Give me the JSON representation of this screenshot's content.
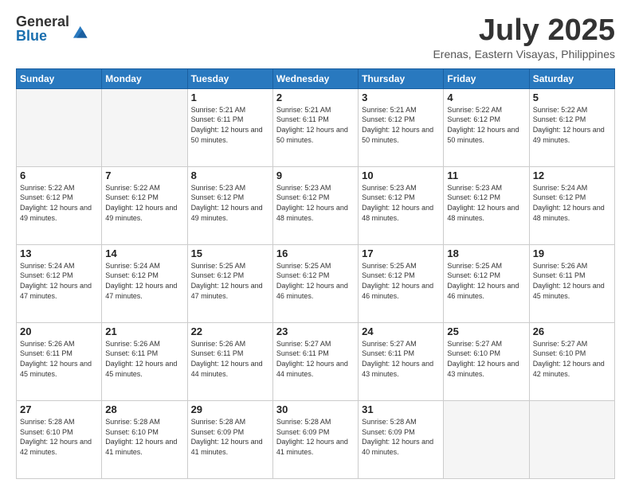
{
  "logo": {
    "general": "General",
    "blue": "Blue"
  },
  "title": "July 2025",
  "location": "Erenas, Eastern Visayas, Philippines",
  "days_of_week": [
    "Sunday",
    "Monday",
    "Tuesday",
    "Wednesday",
    "Thursday",
    "Friday",
    "Saturday"
  ],
  "weeks": [
    [
      {
        "day": "",
        "sunrise": "",
        "sunset": "",
        "daylight": "",
        "empty": true
      },
      {
        "day": "",
        "sunrise": "",
        "sunset": "",
        "daylight": "",
        "empty": true
      },
      {
        "day": "1",
        "sunrise": "Sunrise: 5:21 AM",
        "sunset": "Sunset: 6:11 PM",
        "daylight": "Daylight: 12 hours and 50 minutes.",
        "empty": false
      },
      {
        "day": "2",
        "sunrise": "Sunrise: 5:21 AM",
        "sunset": "Sunset: 6:11 PM",
        "daylight": "Daylight: 12 hours and 50 minutes.",
        "empty": false
      },
      {
        "day": "3",
        "sunrise": "Sunrise: 5:21 AM",
        "sunset": "Sunset: 6:12 PM",
        "daylight": "Daylight: 12 hours and 50 minutes.",
        "empty": false
      },
      {
        "day": "4",
        "sunrise": "Sunrise: 5:22 AM",
        "sunset": "Sunset: 6:12 PM",
        "daylight": "Daylight: 12 hours and 50 minutes.",
        "empty": false
      },
      {
        "day": "5",
        "sunrise": "Sunrise: 5:22 AM",
        "sunset": "Sunset: 6:12 PM",
        "daylight": "Daylight: 12 hours and 49 minutes.",
        "empty": false
      }
    ],
    [
      {
        "day": "6",
        "sunrise": "Sunrise: 5:22 AM",
        "sunset": "Sunset: 6:12 PM",
        "daylight": "Daylight: 12 hours and 49 minutes.",
        "empty": false
      },
      {
        "day": "7",
        "sunrise": "Sunrise: 5:22 AM",
        "sunset": "Sunset: 6:12 PM",
        "daylight": "Daylight: 12 hours and 49 minutes.",
        "empty": false
      },
      {
        "day": "8",
        "sunrise": "Sunrise: 5:23 AM",
        "sunset": "Sunset: 6:12 PM",
        "daylight": "Daylight: 12 hours and 49 minutes.",
        "empty": false
      },
      {
        "day": "9",
        "sunrise": "Sunrise: 5:23 AM",
        "sunset": "Sunset: 6:12 PM",
        "daylight": "Daylight: 12 hours and 48 minutes.",
        "empty": false
      },
      {
        "day": "10",
        "sunrise": "Sunrise: 5:23 AM",
        "sunset": "Sunset: 6:12 PM",
        "daylight": "Daylight: 12 hours and 48 minutes.",
        "empty": false
      },
      {
        "day": "11",
        "sunrise": "Sunrise: 5:23 AM",
        "sunset": "Sunset: 6:12 PM",
        "daylight": "Daylight: 12 hours and 48 minutes.",
        "empty": false
      },
      {
        "day": "12",
        "sunrise": "Sunrise: 5:24 AM",
        "sunset": "Sunset: 6:12 PM",
        "daylight": "Daylight: 12 hours and 48 minutes.",
        "empty": false
      }
    ],
    [
      {
        "day": "13",
        "sunrise": "Sunrise: 5:24 AM",
        "sunset": "Sunset: 6:12 PM",
        "daylight": "Daylight: 12 hours and 47 minutes.",
        "empty": false
      },
      {
        "day": "14",
        "sunrise": "Sunrise: 5:24 AM",
        "sunset": "Sunset: 6:12 PM",
        "daylight": "Daylight: 12 hours and 47 minutes.",
        "empty": false
      },
      {
        "day": "15",
        "sunrise": "Sunrise: 5:25 AM",
        "sunset": "Sunset: 6:12 PM",
        "daylight": "Daylight: 12 hours and 47 minutes.",
        "empty": false
      },
      {
        "day": "16",
        "sunrise": "Sunrise: 5:25 AM",
        "sunset": "Sunset: 6:12 PM",
        "daylight": "Daylight: 12 hours and 46 minutes.",
        "empty": false
      },
      {
        "day": "17",
        "sunrise": "Sunrise: 5:25 AM",
        "sunset": "Sunset: 6:12 PM",
        "daylight": "Daylight: 12 hours and 46 minutes.",
        "empty": false
      },
      {
        "day": "18",
        "sunrise": "Sunrise: 5:25 AM",
        "sunset": "Sunset: 6:12 PM",
        "daylight": "Daylight: 12 hours and 46 minutes.",
        "empty": false
      },
      {
        "day": "19",
        "sunrise": "Sunrise: 5:26 AM",
        "sunset": "Sunset: 6:11 PM",
        "daylight": "Daylight: 12 hours and 45 minutes.",
        "empty": false
      }
    ],
    [
      {
        "day": "20",
        "sunrise": "Sunrise: 5:26 AM",
        "sunset": "Sunset: 6:11 PM",
        "daylight": "Daylight: 12 hours and 45 minutes.",
        "empty": false
      },
      {
        "day": "21",
        "sunrise": "Sunrise: 5:26 AM",
        "sunset": "Sunset: 6:11 PM",
        "daylight": "Daylight: 12 hours and 45 minutes.",
        "empty": false
      },
      {
        "day": "22",
        "sunrise": "Sunrise: 5:26 AM",
        "sunset": "Sunset: 6:11 PM",
        "daylight": "Daylight: 12 hours and 44 minutes.",
        "empty": false
      },
      {
        "day": "23",
        "sunrise": "Sunrise: 5:27 AM",
        "sunset": "Sunset: 6:11 PM",
        "daylight": "Daylight: 12 hours and 44 minutes.",
        "empty": false
      },
      {
        "day": "24",
        "sunrise": "Sunrise: 5:27 AM",
        "sunset": "Sunset: 6:11 PM",
        "daylight": "Daylight: 12 hours and 43 minutes.",
        "empty": false
      },
      {
        "day": "25",
        "sunrise": "Sunrise: 5:27 AM",
        "sunset": "Sunset: 6:10 PM",
        "daylight": "Daylight: 12 hours and 43 minutes.",
        "empty": false
      },
      {
        "day": "26",
        "sunrise": "Sunrise: 5:27 AM",
        "sunset": "Sunset: 6:10 PM",
        "daylight": "Daylight: 12 hours and 42 minutes.",
        "empty": false
      }
    ],
    [
      {
        "day": "27",
        "sunrise": "Sunrise: 5:28 AM",
        "sunset": "Sunset: 6:10 PM",
        "daylight": "Daylight: 12 hours and 42 minutes.",
        "empty": false
      },
      {
        "day": "28",
        "sunrise": "Sunrise: 5:28 AM",
        "sunset": "Sunset: 6:10 PM",
        "daylight": "Daylight: 12 hours and 41 minutes.",
        "empty": false
      },
      {
        "day": "29",
        "sunrise": "Sunrise: 5:28 AM",
        "sunset": "Sunset: 6:09 PM",
        "daylight": "Daylight: 12 hours and 41 minutes.",
        "empty": false
      },
      {
        "day": "30",
        "sunrise": "Sunrise: 5:28 AM",
        "sunset": "Sunset: 6:09 PM",
        "daylight": "Daylight: 12 hours and 41 minutes.",
        "empty": false
      },
      {
        "day": "31",
        "sunrise": "Sunrise: 5:28 AM",
        "sunset": "Sunset: 6:09 PM",
        "daylight": "Daylight: 12 hours and 40 minutes.",
        "empty": false
      },
      {
        "day": "",
        "sunrise": "",
        "sunset": "",
        "daylight": "",
        "empty": true
      },
      {
        "day": "",
        "sunrise": "",
        "sunset": "",
        "daylight": "",
        "empty": true
      }
    ]
  ]
}
